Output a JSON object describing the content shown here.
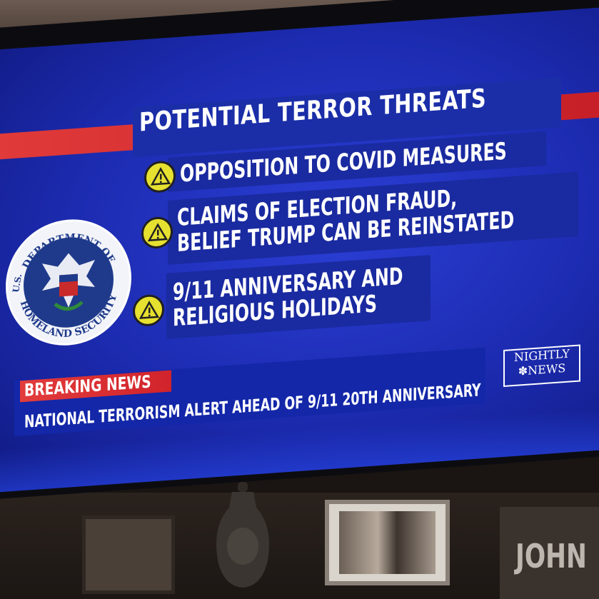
{
  "screen": {
    "title": "POTENTIAL TERROR THREATS",
    "items": [
      {
        "lines": [
          "OPPOSITION TO COVID MEASURES"
        ]
      },
      {
        "lines": [
          "CLAIMS OF ELECTION FRAUD,",
          "BELIEF TRUMP CAN BE REINSTATED"
        ]
      },
      {
        "lines": [
          "9/11 ANNIVERSARY AND",
          "RELIGIOUS HOLIDAYS"
        ]
      }
    ],
    "seal": {
      "text_top": "DEPARTMENT OF",
      "text_left": "U.S.",
      "text_bottom": "HOMELAND SECURITY"
    },
    "breaking_label": "BREAKING NEWS",
    "headline": "NATIONAL TERRORISM ALERT AHEAD OF 9/11 20TH ANNIVERSARY",
    "logo_line1": "NIGHTLY",
    "logo_line2": "NEWS"
  },
  "room": {
    "sign_text": "JOHN"
  },
  "colors": {
    "screen_blue": "#1c2bb0",
    "stripe_red": "#d1232b",
    "warning_yellow": "#e6e030"
  }
}
